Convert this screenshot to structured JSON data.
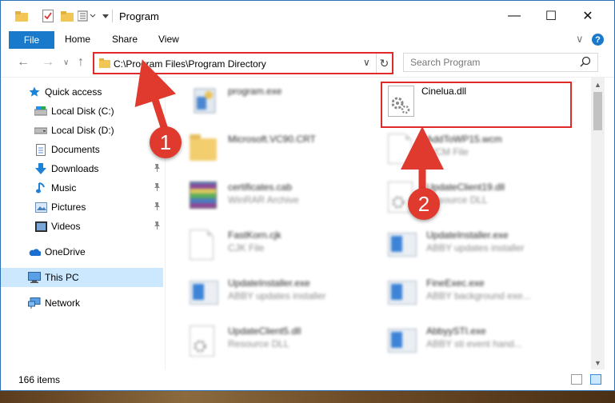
{
  "window": {
    "title": "Program",
    "minimize_glyph": "—",
    "maximize_glyph": "☐",
    "close_glyph": "✕"
  },
  "ribbon": {
    "file_tab": "File",
    "tabs": [
      "Home",
      "Share",
      "View"
    ],
    "expand_glyph": "∨",
    "help_glyph": "?"
  },
  "nav": {
    "back_glyph": "←",
    "forward_glyph": "→",
    "recent_glyph": "∨",
    "up_glyph": "↑",
    "address": "C:\\Program Files\\Program Directory",
    "address_dropdown_glyph": "∨",
    "refresh_glyph": "↻",
    "search_placeholder": "Search Program",
    "search_glyph": "⚲"
  },
  "sidebar": {
    "items": [
      {
        "label": "Quick access",
        "icon": "star-icon"
      },
      {
        "label": "Local Disk (C:)",
        "icon": "drive-icon"
      },
      {
        "label": "Local Disk (D:)",
        "icon": "drive-icon"
      },
      {
        "label": "Documents",
        "icon": "documents-icon"
      },
      {
        "label": "Downloads",
        "icon": "download-icon"
      },
      {
        "label": "Music",
        "icon": "music-icon"
      },
      {
        "label": "Pictures",
        "icon": "pictures-icon"
      },
      {
        "label": "Videos",
        "icon": "videos-icon"
      },
      {
        "label": "OneDrive",
        "icon": "cloud-icon"
      },
      {
        "label": "This PC",
        "icon": "computer-icon"
      },
      {
        "label": "Network",
        "icon": "network-icon"
      }
    ],
    "pin_glyph": "📌"
  },
  "files": [
    {
      "name": "program.exe",
      "type": ""
    },
    {
      "name": "Microsoft.VC90.CRT",
      "type": ""
    },
    {
      "name": "certificates.cab",
      "type": "WinRAR Archive"
    },
    {
      "name": "FastKorn.cjk",
      "type": "CJK File"
    },
    {
      "name": "UpdateInstaller.exe",
      "type": "ABBY updates installer"
    },
    {
      "name": "UpdateClient5.dll",
      "type": "Resource DLL"
    },
    {
      "name": "Cinelua.dll",
      "type": ""
    },
    {
      "name": "AddToWP15.wcm",
      "type": "WCM File"
    },
    {
      "name": "UpdateClient19.dll",
      "type": "Resource DLL"
    },
    {
      "name": "UpdateInstaller.exe",
      "type": "ABBY updates installer"
    },
    {
      "name": "FineExec.exe",
      "type": "ABBY background exe..."
    },
    {
      "name": "AbbyySTI.exe",
      "type": "ABBY sti event hand..."
    }
  ],
  "status": {
    "item_count": "166 items"
  },
  "annotations": {
    "step1": "1",
    "step2": "2",
    "color": "#e0392e"
  },
  "colors": {
    "accent": "#1979ca",
    "highlight_border": "#e02a2a",
    "selected_bg": "#cce8ff"
  }
}
